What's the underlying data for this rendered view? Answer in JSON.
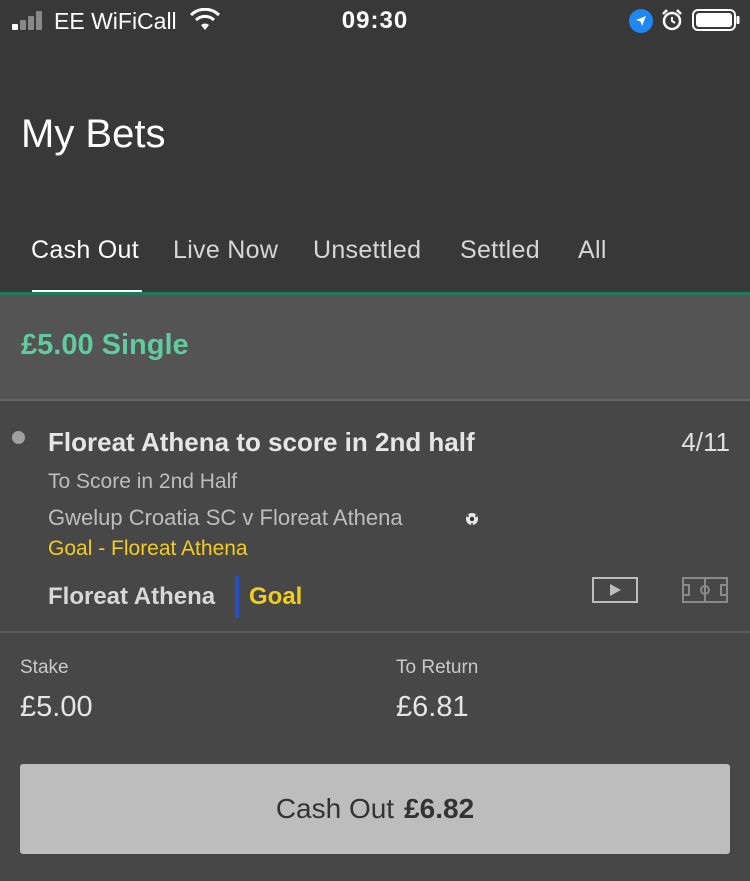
{
  "status_bar": {
    "carrier": "EE WiFiCall",
    "time": "09:30",
    "icons": [
      "signal-icon",
      "wifi-icon",
      "location-icon",
      "alarm-icon",
      "battery-icon"
    ]
  },
  "header": {
    "title": "My Bets"
  },
  "tabs": [
    {
      "label": "Cash Out",
      "active": true
    },
    {
      "label": "Live Now",
      "active": false
    },
    {
      "label": "Unsettled",
      "active": false
    },
    {
      "label": "Settled",
      "active": false
    },
    {
      "label": "All",
      "active": false
    }
  ],
  "bet": {
    "type_label": "£5.00 Single",
    "selection": {
      "title": "Floreat Athena to score in 2nd half",
      "odds": "4/11",
      "market": "To Score in 2nd Half",
      "event": "Gwelup Croatia SC v Floreat Athena",
      "result": "Goal - Floreat Athena",
      "team": "Floreat Athena",
      "incident": "Goal"
    },
    "stake_label": "Stake",
    "stake_value": "£5.00",
    "return_label": "To Return",
    "return_value": "£6.81",
    "cashout_label": "Cash Out",
    "cashout_amount": "£6.82"
  },
  "colors": {
    "accent_green": "#5fcc9f",
    "goal_yellow": "#f2cd1c",
    "team_bar_blue": "#2550c8",
    "location_blue": "#1e88f0"
  }
}
